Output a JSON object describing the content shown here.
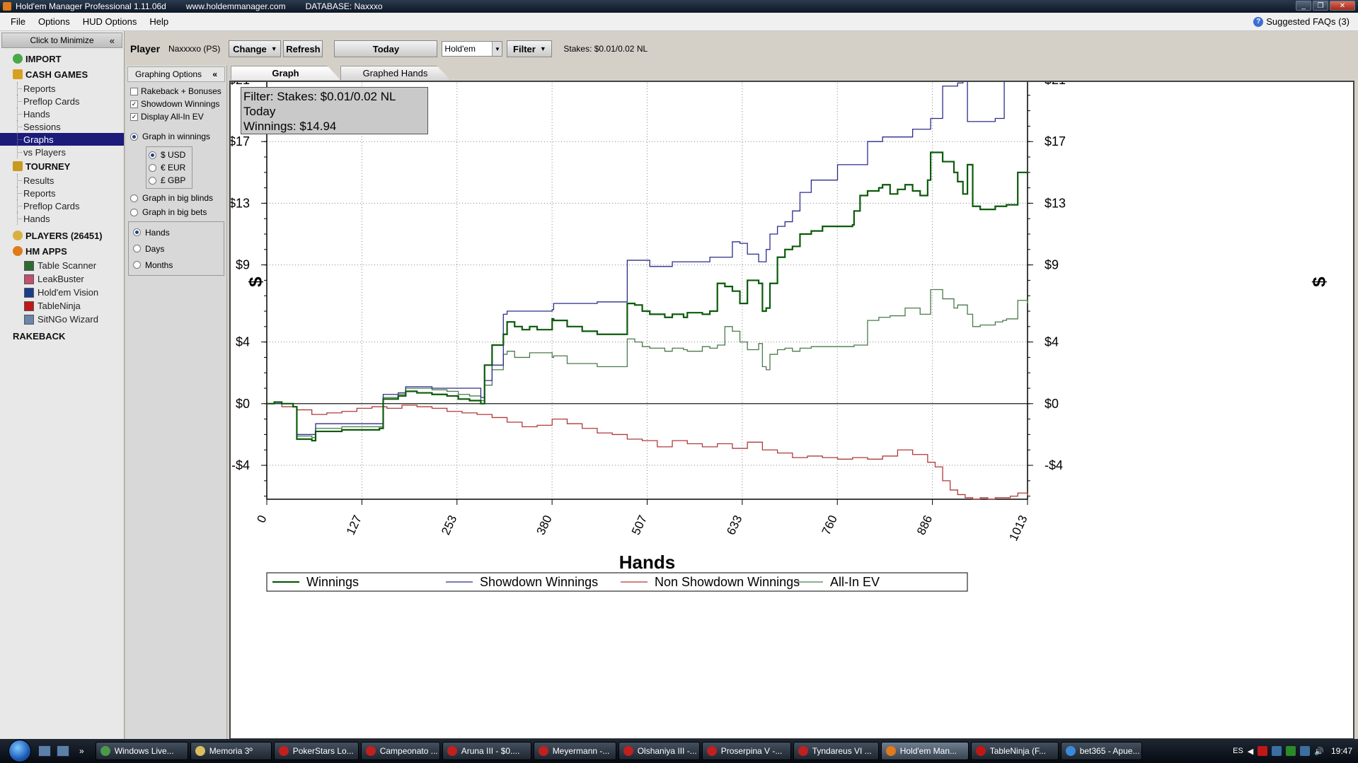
{
  "window": {
    "title": "Hold'em Manager Professional 1.11.06d",
    "website": "www.holdemmanager.com",
    "database": "DATABASE: Naxxxo",
    "controls": [
      "_",
      "❐",
      "✕"
    ]
  },
  "menu": {
    "items": [
      "File",
      "Options",
      "HUD Options",
      "Help"
    ],
    "faq": "Suggested FAQs (3)",
    "faq_icon": "?"
  },
  "sidebar": {
    "minimize": "Click to Minimize",
    "minimize_chevron": "«",
    "import": "IMPORT",
    "cash_games": {
      "label": "CASH GAMES",
      "items": [
        "Reports",
        "Preflop Cards",
        "Hands",
        "Sessions",
        "Graphs",
        "vs Players"
      ],
      "selected": "Graphs"
    },
    "tourney": {
      "label": "TOURNEY",
      "items": [
        "Results",
        "Reports",
        "Preflop Cards",
        "Hands"
      ]
    },
    "players": "PLAYERS (26451)",
    "hm_apps": {
      "label": "HM APPS",
      "items": [
        {
          "label": "Table Scanner",
          "color": "#2e6b2e"
        },
        {
          "label": "LeakBuster",
          "color": "#c0506e"
        },
        {
          "label": "Hold'em Vision",
          "color": "#1b3c8c"
        },
        {
          "label": "TableNinja",
          "color": "#c01818"
        },
        {
          "label": "SitNGo Wizard",
          "color": "#6a86a8"
        }
      ]
    },
    "rakeback": "RAKEBACK"
  },
  "toolbar": {
    "player_label": "Player",
    "player_value": "Naxxxxo (PS)",
    "change": "Change",
    "refresh": "Refresh",
    "today": "Today",
    "game": "Hold'em",
    "filter": "Filter",
    "stakes": "Stakes: $0.01/0.02 NL"
  },
  "graph_options": {
    "header": "Graphing Options",
    "chevron": "«",
    "checkboxes": [
      {
        "label": "Rakeback + Bonuses",
        "checked": false
      },
      {
        "label": "Showdown Winnings",
        "checked": true
      },
      {
        "label": "Display All-In EV",
        "checked": true
      }
    ],
    "winnings_mode": "Graph in winnings",
    "currencies": [
      "$ USD",
      "€ EUR",
      "£ GBP"
    ],
    "currency_selected": "$ USD",
    "big_blinds": "Graph in big blinds",
    "big_bets": "Graph in big bets",
    "x_axis_options": [
      "Hands",
      "Days",
      "Months"
    ],
    "x_axis_selected": "Hands"
  },
  "tabs": {
    "items": [
      "Graph",
      "Graphed Hands"
    ],
    "active": "Graph"
  },
  "filter_box": {
    "line1": "Filter: Stakes: $0.01/0.02 NL",
    "line2": "Today",
    "line3": "Winnings: $14.94"
  },
  "chart_data": {
    "type": "line",
    "xlabel": "Hands",
    "ylabel": "$",
    "xlim": [
      0,
      1013
    ],
    "ylim": [
      -6.2,
      21
    ],
    "xticks": [
      "0",
      "127",
      "253",
      "380",
      "507",
      "633",
      "760",
      "886",
      "1013"
    ],
    "yticks": [
      "$21",
      "$17",
      "$13",
      "$9",
      "$4",
      "$0",
      "-$4"
    ],
    "ytick_values": [
      21,
      17,
      13,
      9,
      4,
      0,
      -4
    ],
    "grid": true,
    "legend_position": "bottom",
    "series": [
      {
        "name": "Winnings",
        "color": "#0b5a0b",
        "x": [
          0,
          10,
          20,
          35,
          40,
          60,
          65,
          80,
          100,
          120,
          150,
          155,
          175,
          185,
          200,
          220,
          240,
          255,
          270,
          285,
          290,
          300,
          315,
          320,
          330,
          340,
          350,
          360,
          380,
          382,
          400,
          420,
          440,
          470,
          480,
          490,
          500,
          510,
          530,
          540,
          550,
          555,
          560,
          580,
          590,
          600,
          610,
          620,
          630,
          640,
          655,
          660,
          665,
          670,
          680,
          690,
          700,
          710,
          725,
          740,
          760,
          780,
          782,
          790,
          800,
          815,
          820,
          830,
          840,
          850,
          860,
          870,
          880,
          884,
          900,
          915,
          920,
          927,
          933,
          940,
          950,
          970,
          980,
          985,
          1000,
          1013
        ],
        "y": [
          0,
          0.1,
          0,
          -0.2,
          -2.3,
          -2.4,
          -1.8,
          -1.8,
          -1.7,
          -1.7,
          -1.6,
          0.3,
          0.5,
          0.8,
          0.7,
          0.6,
          0.5,
          0.3,
          0.2,
          0,
          2.5,
          3.8,
          4.5,
          5.3,
          5.0,
          4.8,
          5.0,
          4.8,
          5.5,
          5.4,
          5.0,
          4.7,
          4.5,
          4.5,
          6.5,
          6.4,
          6.0,
          5.8,
          5.6,
          5.8,
          5.8,
          5.6,
          5.9,
          5.8,
          6.0,
          7.8,
          7.6,
          7.3,
          6.5,
          8.0,
          7.8,
          6.0,
          6.2,
          7.8,
          9.5,
          10.0,
          10.2,
          11.0,
          11.2,
          11.5,
          11.5,
          11.6,
          12.5,
          13.5,
          13.8,
          14.0,
          14.2,
          13.6,
          13.9,
          14.2,
          13.8,
          13.5,
          14.5,
          16.3,
          15.7,
          15.0,
          14.4,
          13.6,
          15.5,
          12.8,
          12.6,
          12.8,
          12.8,
          12.9,
          15.0,
          14.9
        ]
      },
      {
        "name": "Showdown Winnings",
        "color": "#2c2c8c",
        "x": [
          0,
          20,
          35,
          40,
          60,
          65,
          80,
          100,
          150,
          155,
          175,
          185,
          220,
          240,
          255,
          270,
          285,
          290,
          300,
          315,
          320,
          380,
          382,
          440,
          480,
          500,
          510,
          540,
          555,
          590,
          600,
          610,
          620,
          630,
          640,
          655,
          660,
          665,
          670,
          680,
          690,
          700,
          710,
          725,
          760,
          780,
          782,
          800,
          820,
          850,
          860,
          884,
          900,
          920,
          927,
          933,
          970,
          982,
          1000,
          1013
        ],
        "y": [
          0,
          0,
          -0.2,
          -2.0,
          -2.0,
          -1.3,
          -1.3,
          -1.3,
          -1.3,
          0.6,
          0.7,
          1.1,
          1.0,
          1.0,
          1.0,
          1.0,
          0.4,
          1.5,
          2.5,
          5.8,
          6.0,
          6.1,
          6.5,
          6.6,
          9.3,
          9.3,
          8.9,
          9.2,
          9.2,
          9.5,
          9.5,
          9.5,
          10.5,
          10.4,
          9.7,
          9.2,
          9.2,
          10.0,
          11.0,
          11.5,
          11.8,
          12.5,
          13.7,
          14.5,
          15.5,
          15.5,
          15.5,
          17.0,
          17.3,
          17.3,
          17.8,
          18.5,
          20.6,
          20.8,
          21.0,
          18.3,
          18.5,
          21.0,
          21.0,
          21.0
        ]
      },
      {
        "name": "Non Showdown Winnings",
        "color": "#b03a3a",
        "x": [
          0,
          20,
          40,
          60,
          80,
          100,
          120,
          140,
          160,
          180,
          200,
          220,
          240,
          260,
          280,
          300,
          320,
          340,
          360,
          380,
          400,
          420,
          440,
          460,
          480,
          500,
          520,
          540,
          560,
          580,
          600,
          620,
          640,
          660,
          680,
          700,
          720,
          740,
          760,
          780,
          800,
          820,
          840,
          860,
          880,
          890,
          900,
          910,
          920,
          930,
          940,
          950,
          960,
          970,
          980,
          990,
          1000,
          1013
        ],
        "y": [
          0,
          -0.2,
          -0.4,
          -0.7,
          -0.6,
          -0.5,
          -0.3,
          -0.2,
          -0.3,
          -0.1,
          -0.2,
          -0.3,
          -0.5,
          -0.6,
          -0.7,
          -0.9,
          -1.2,
          -1.5,
          -1.4,
          -1.0,
          -1.3,
          -1.6,
          -1.9,
          -2.0,
          -2.3,
          -2.4,
          -2.8,
          -2.4,
          -2.6,
          -2.8,
          -2.6,
          -2.9,
          -2.5,
          -3.0,
          -3.2,
          -3.5,
          -3.4,
          -3.5,
          -3.6,
          -3.5,
          -3.6,
          -3.4,
          -3.0,
          -3.3,
          -3.8,
          -4.1,
          -5.0,
          -5.6,
          -5.9,
          -6.1,
          -6.2,
          -6.1,
          -6.2,
          -6.1,
          -6.1,
          -6.0,
          -5.8,
          -6.0
        ]
      },
      {
        "name": "All-In EV",
        "color": "#4a7a4a",
        "x": [
          0,
          20,
          35,
          40,
          60,
          65,
          80,
          100,
          120,
          150,
          155,
          175,
          185,
          220,
          240,
          255,
          270,
          285,
          290,
          300,
          315,
          320,
          330,
          350,
          380,
          382,
          400,
          420,
          440,
          470,
          480,
          490,
          500,
          510,
          530,
          540,
          555,
          560,
          580,
          590,
          600,
          610,
          620,
          630,
          640,
          655,
          660,
          665,
          670,
          680,
          690,
          700,
          710,
          725,
          760,
          780,
          782,
          800,
          815,
          830,
          850,
          870,
          884,
          900,
          915,
          920,
          933,
          940,
          950,
          970,
          980,
          985,
          1000,
          1013
        ],
        "y": [
          0,
          0,
          -0.2,
          -2.1,
          -2.2,
          -1.6,
          -1.6,
          -1.5,
          -1.5,
          -1.5,
          0.4,
          0.6,
          1.0,
          0.9,
          0.8,
          0.6,
          0.5,
          0.2,
          1.2,
          2.2,
          3.2,
          3.4,
          3.0,
          3.3,
          3.0,
          3.1,
          2.6,
          2.6,
          2.4,
          2.4,
          4.2,
          4.0,
          3.7,
          3.6,
          3.4,
          3.6,
          3.5,
          3.4,
          3.7,
          3.6,
          3.8,
          5.0,
          4.7,
          4.0,
          3.5,
          3.9,
          2.4,
          2.2,
          3.2,
          3.5,
          3.6,
          3.4,
          3.6,
          3.7,
          3.7,
          3.7,
          3.8,
          5.4,
          5.6,
          5.7,
          6.2,
          5.8,
          7.4,
          6.8,
          6.2,
          6.4,
          5.8,
          5.0,
          5.1,
          5.3,
          5.4,
          5.5,
          6.7,
          6.5
        ]
      }
    ]
  },
  "taskbar": {
    "items": [
      {
        "label": "Windows Live...",
        "color": "#4a9a4a"
      },
      {
        "label": "Memoria 3º",
        "color": "#d8c060"
      },
      {
        "label": "PokerStars Lo...",
        "color": "#c02020"
      },
      {
        "label": "Campeonato ...",
        "color": "#c02020"
      },
      {
        "label": "Aruna III - $0....",
        "color": "#c02020"
      },
      {
        "label": "Meyermann -...",
        "color": "#c02020"
      },
      {
        "label": "Olshaniya III -...",
        "color": "#c02020"
      },
      {
        "label": "Proserpina V -...",
        "color": "#c02020"
      },
      {
        "label": "Tyndareus VI ...",
        "color": "#c02020"
      },
      {
        "label": "Hold'em Man...",
        "color": "#e07a1a"
      },
      {
        "label": "TableNinja (F...",
        "color": "#c01818"
      },
      {
        "label": "bet365 - Apue...",
        "color": "#3b8ad8"
      }
    ],
    "active": "Hold'em Man...",
    "lang": "ES",
    "clock": "19:47"
  }
}
